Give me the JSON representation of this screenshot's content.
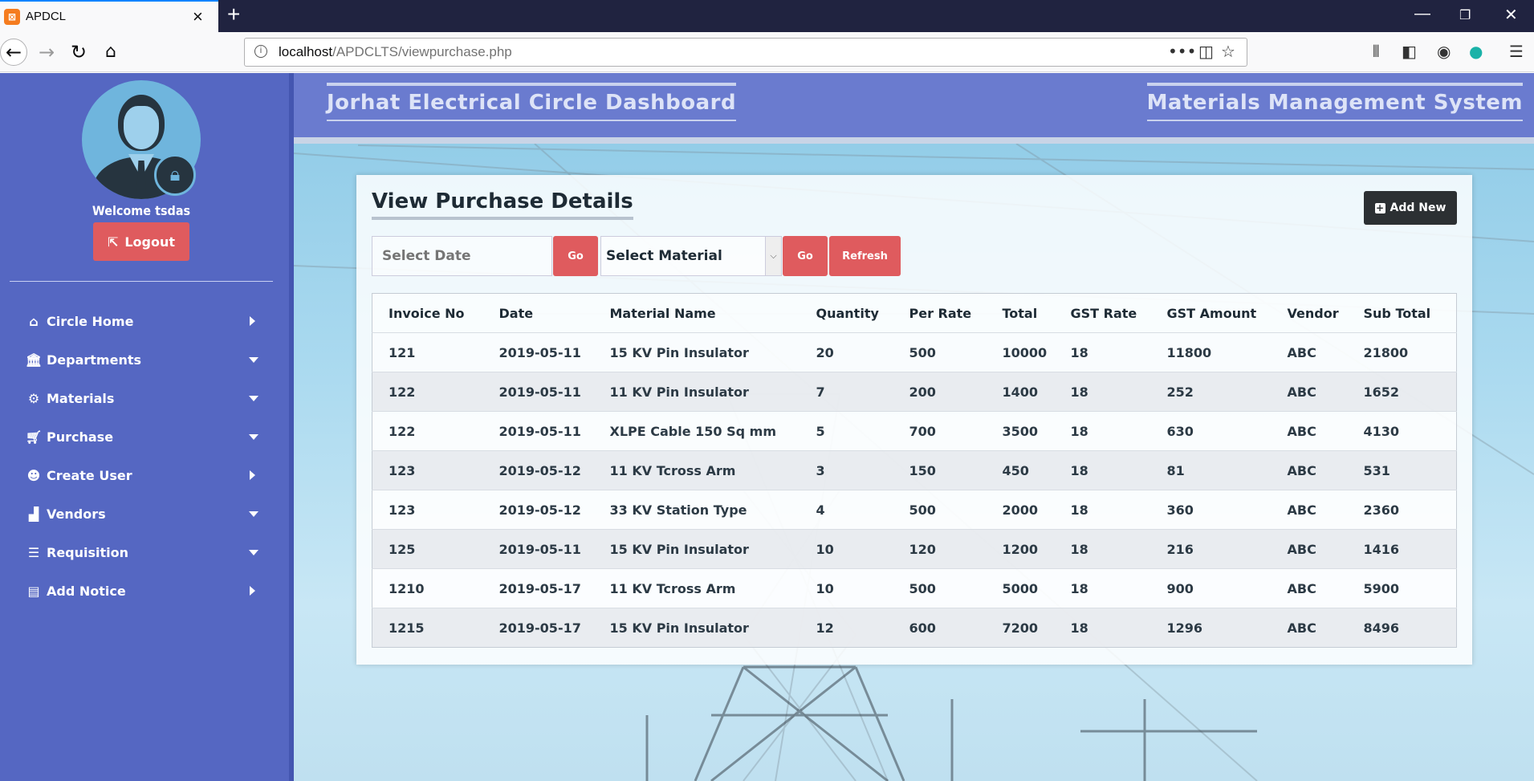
{
  "browser": {
    "tab_title": "APDCL",
    "url_host": "localhost",
    "url_path": "/APDCLTS/viewpurchase.php"
  },
  "sidebar": {
    "welcome": "Welcome tsdas",
    "logout_label": "Logout",
    "items": [
      {
        "label": "Circle Home",
        "icon": "home-icon",
        "arrow": "right"
      },
      {
        "label": "Departments",
        "icon": "bank-icon",
        "arrow": "down"
      },
      {
        "label": "Materials",
        "icon": "cogs-icon",
        "arrow": "down"
      },
      {
        "label": "Purchase",
        "icon": "cart-icon",
        "arrow": "down"
      },
      {
        "label": "Create User",
        "icon": "user-circle-icon",
        "arrow": "right"
      },
      {
        "label": "Vendors",
        "icon": "factory-icon",
        "arrow": "down"
      },
      {
        "label": "Requisition",
        "icon": "list-icon",
        "arrow": "down"
      },
      {
        "label": "Add Notice",
        "icon": "newspaper-icon",
        "arrow": "right"
      }
    ]
  },
  "header": {
    "left_title": "Jorhat Electrical Circle Dashboard",
    "right_title": "Materials Management System"
  },
  "panel": {
    "title": "View Purchase Details",
    "add_new_label": "Add New",
    "date_placeholder": "Select Date",
    "go_label": "Go",
    "material_select_value": "Select Material",
    "refresh_label": "Refresh"
  },
  "table": {
    "columns": [
      "Invoice No",
      "Date",
      "Material Name",
      "Quantity",
      "Per Rate",
      "Total",
      "GST Rate",
      "GST Amount",
      "Vendor",
      "Sub Total"
    ],
    "rows": [
      [
        "121",
        "2019-05-11",
        "15 KV Pin Insulator",
        "20",
        "500",
        "10000",
        "18",
        "11800",
        "ABC",
        "21800"
      ],
      [
        "122",
        "2019-05-11",
        "11 KV Pin Insulator",
        "7",
        "200",
        "1400",
        "18",
        "252",
        "ABC",
        "1652"
      ],
      [
        "122",
        "2019-05-11",
        "XLPE Cable 150 Sq mm",
        "5",
        "700",
        "3500",
        "18",
        "630",
        "ABC",
        "4130"
      ],
      [
        "123",
        "2019-05-12",
        "11 KV Tcross Arm",
        "3",
        "150",
        "450",
        "18",
        "81",
        "ABC",
        "531"
      ],
      [
        "123",
        "2019-05-12",
        "33 KV Station Type",
        "4",
        "500",
        "2000",
        "18",
        "360",
        "ABC",
        "2360"
      ],
      [
        "125",
        "2019-05-11",
        "15 KV Pin Insulator",
        "10",
        "120",
        "1200",
        "18",
        "216",
        "ABC",
        "1416"
      ],
      [
        "1210",
        "2019-05-17",
        "11 KV Tcross Arm",
        "10",
        "500",
        "5000",
        "18",
        "900",
        "ABC",
        "5900"
      ],
      [
        "1215",
        "2019-05-17",
        "15 KV Pin Insulator",
        "12",
        "600",
        "7200",
        "18",
        "1296",
        "ABC",
        "8496"
      ]
    ]
  },
  "colors": {
    "sidebar_bg": "#5567c2",
    "header_bg": "#6a7bcf",
    "danger_button": "#df5b5e",
    "dark_button": "#2c3033"
  }
}
